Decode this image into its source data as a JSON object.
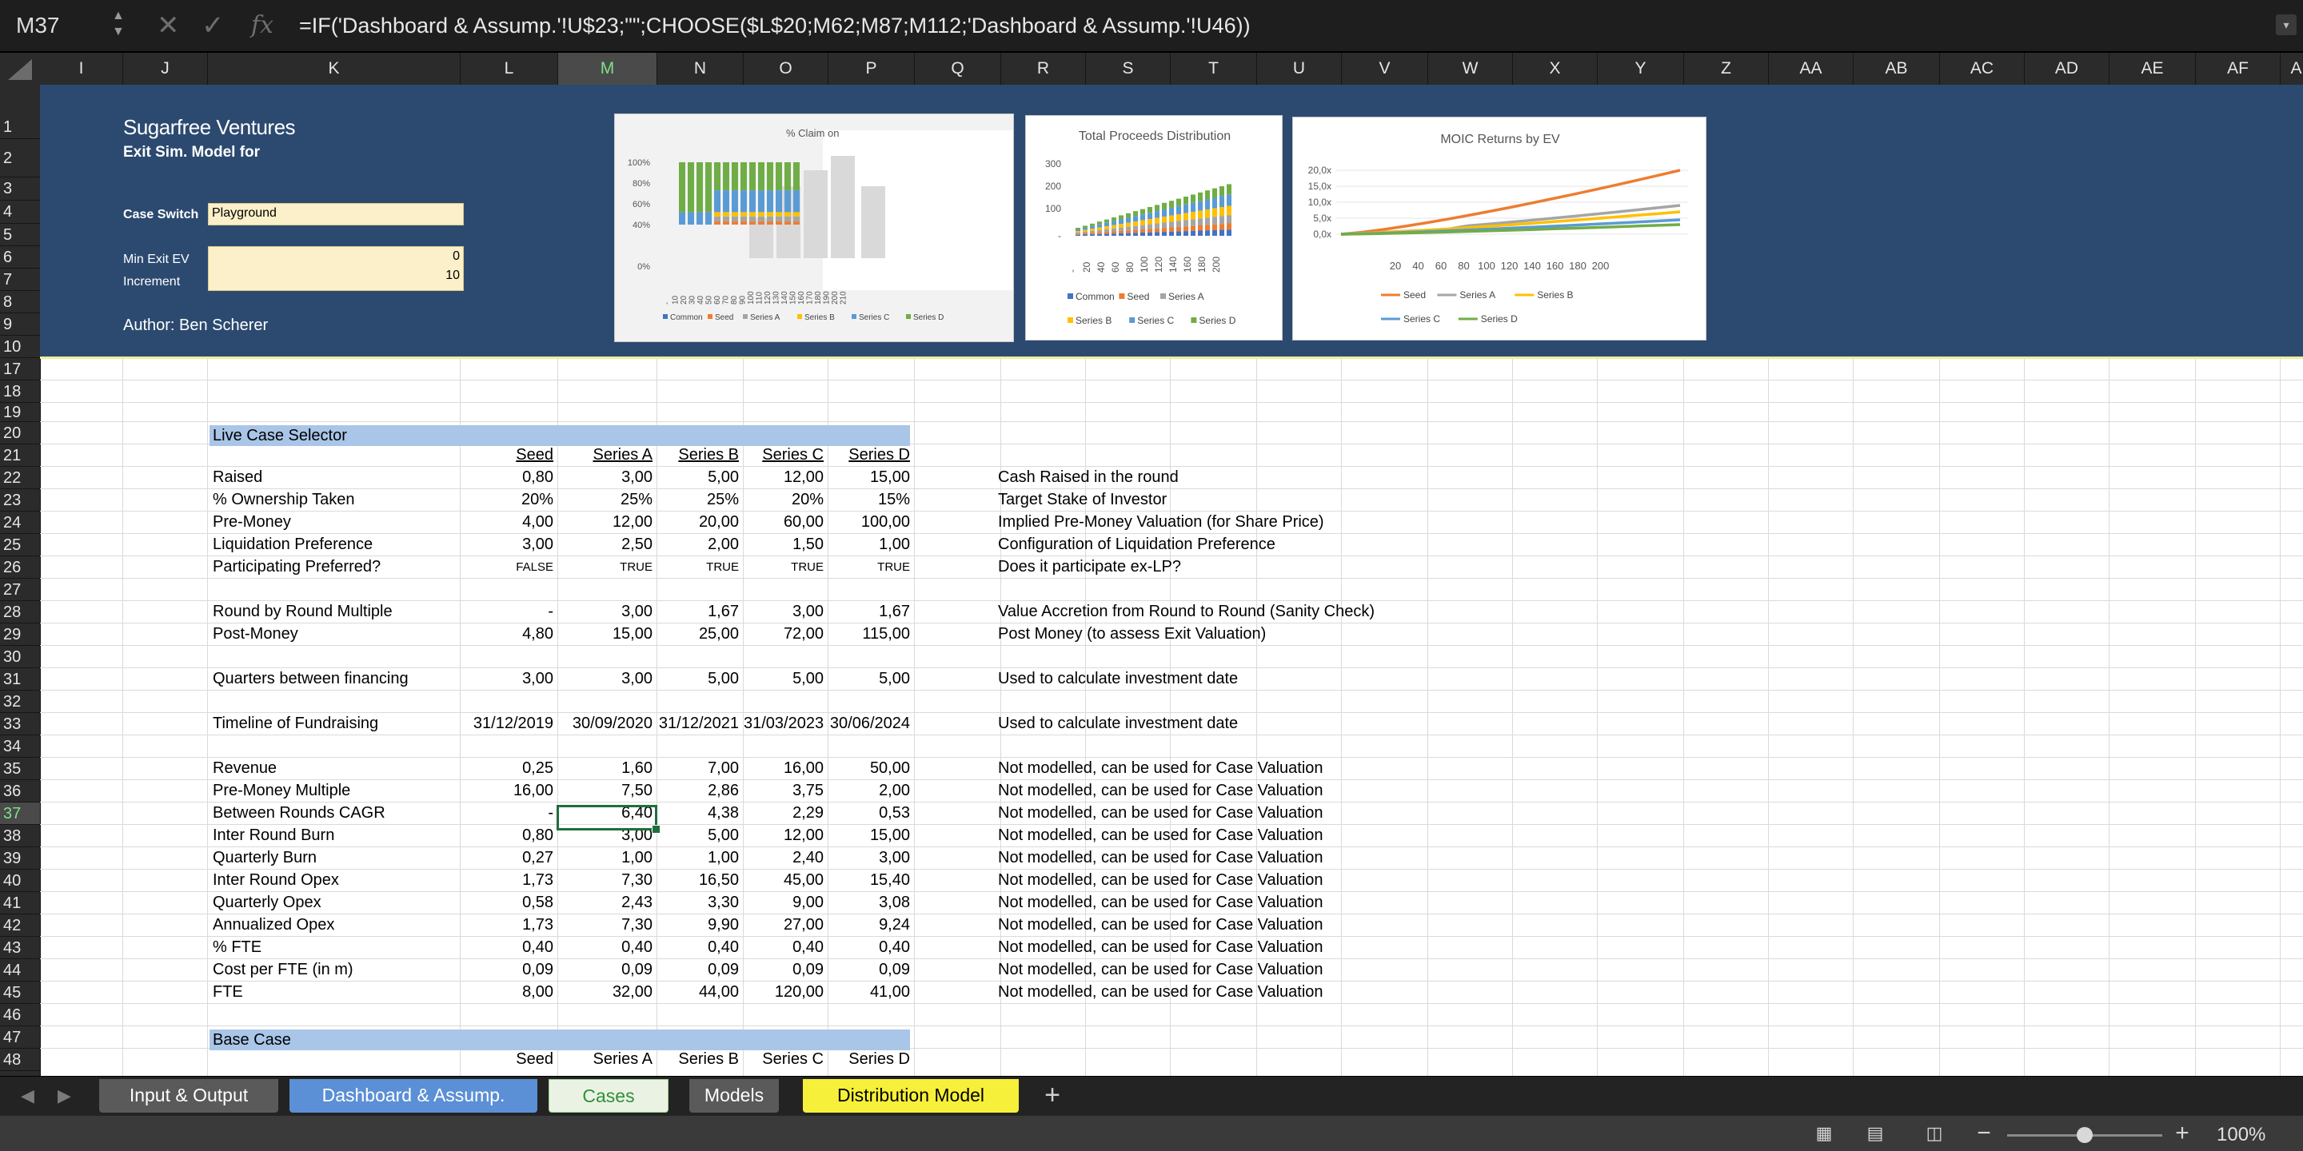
{
  "formula_bar": {
    "cell_ref": "M37",
    "formula": "=IF('Dashboard & Assump.'!U$23;\"\";CHOOSE($L$20;M62;M87;M112;'Dashboard & Assump.'!U46))",
    "cancel_icon": "close-icon",
    "enter_icon": "checkmark-icon",
    "fx_label": "fx"
  },
  "columns": [
    "I",
    "J",
    "K",
    "L",
    "M",
    "N",
    "O",
    "P",
    "Q",
    "R",
    "S",
    "T",
    "U",
    "V",
    "W",
    "X",
    "Y",
    "Z",
    "AA",
    "AB",
    "AC",
    "AD",
    "AE",
    "AF",
    "A"
  ],
  "selected_column": "M",
  "rows": [
    "1",
    "2",
    "3",
    "4",
    "5",
    "6",
    "7",
    "8",
    "9",
    "10",
    "17",
    "18",
    "19",
    "20",
    "21",
    "22",
    "23",
    "24",
    "25",
    "26",
    "27",
    "28",
    "29",
    "30",
    "31",
    "32",
    "33",
    "34",
    "35",
    "36",
    "37",
    "38",
    "39",
    "40",
    "41",
    "42",
    "43",
    "44",
    "45",
    "46",
    "47",
    "48"
  ],
  "selected_row": "37",
  "header": {
    "company": "Sugarfree Ventures",
    "subtitle": "Exit Sim. Model for",
    "case_switch_label": "Case Switch",
    "case_switch_value": "Playground",
    "min_exit_label": "Min Exit EV",
    "min_exit_value": "0",
    "increment_label": "Increment",
    "increment_value": "10",
    "author": "Author: Ben Scherer"
  },
  "charts": {
    "claim": {
      "title": "% Claim on",
      "yticks": [
        "100%",
        "80%",
        "60%",
        "40%",
        "0%"
      ],
      "xticks": [
        "-",
        "10",
        "20",
        "30",
        "40",
        "50",
        "60",
        "70",
        "80",
        "90",
        "100",
        "110",
        "120",
        "130",
        "140",
        "150",
        "160",
        "170",
        "180",
        "190",
        "200",
        "210"
      ],
      "legend": [
        "Common",
        "Seed",
        "Series A",
        "Series B",
        "Series C",
        "Series D"
      ]
    },
    "proceeds": {
      "title": "Total Proceeds Distribution",
      "yticks": [
        "300",
        "200",
        "100",
        "-"
      ],
      "xticks": [
        "-",
        "20",
        "40",
        "60",
        "80",
        "100",
        "120",
        "140",
        "160",
        "180",
        "200"
      ],
      "legend": [
        "Common",
        "Seed",
        "Series A",
        "Series B",
        "Series C",
        "Series D"
      ]
    },
    "moic": {
      "title": "MOIC Returns by EV",
      "yticks": [
        "20,0x",
        "15,0x",
        "10,0x",
        "5,0x",
        "0,0x"
      ],
      "xticks": [
        "20",
        "40",
        "60",
        "80",
        "100",
        "120",
        "140",
        "160",
        "180",
        "200"
      ],
      "legend": [
        "Seed",
        "Series A",
        "Series B",
        "Series C",
        "Series D"
      ]
    }
  },
  "series_colors": {
    "Common": "#4472c4",
    "Seed": "#ed7d31",
    "Series A": "#a5a5a5",
    "Series B": "#ffc000",
    "Series C": "#5b9bd5",
    "Series D": "#70ad47"
  },
  "live_case": {
    "title": "Live Case Selector",
    "headers": [
      "Seed",
      "Series A",
      "Series B",
      "Series C",
      "Series D"
    ],
    "rows": [
      {
        "row": "22",
        "label": "Raised",
        "values": [
          "0,80",
          "3,00",
          "5,00",
          "12,00",
          "15,00"
        ],
        "note": "Cash Raised in the round"
      },
      {
        "row": "23",
        "label": "% Ownership Taken",
        "values": [
          "20%",
          "25%",
          "25%",
          "20%",
          "15%"
        ],
        "note": "Target Stake of Investor"
      },
      {
        "row": "24",
        "label": "Pre-Money",
        "values": [
          "4,00",
          "12,00",
          "20,00",
          "60,00",
          "100,00"
        ],
        "note": "Implied Pre-Money Valuation (for Share Price)"
      },
      {
        "row": "25",
        "label": "Liquidation Preference",
        "values": [
          "3,00",
          "2,50",
          "2,00",
          "1,50",
          "1,00"
        ],
        "note": "Configuration of Liquidation Preference"
      },
      {
        "row": "26",
        "label": "Participating Preferred?",
        "values": [
          "FALSE",
          "TRUE",
          "TRUE",
          "TRUE",
          "TRUE"
        ],
        "note": "Does it participate ex-LP?",
        "small": true
      },
      {
        "row": "28",
        "label": "Round by Round Multiple",
        "values": [
          "-",
          "3,00",
          "1,67",
          "3,00",
          "1,67"
        ],
        "note": "Value Accretion from Round to Round (Sanity Check)"
      },
      {
        "row": "29",
        "label": "Post-Money",
        "values": [
          "4,80",
          "15,00",
          "25,00",
          "72,00",
          "115,00"
        ],
        "note": "Post Money (to assess Exit Valuation)"
      },
      {
        "row": "31",
        "label": "Quarters between financing",
        "values": [
          "3,00",
          "3,00",
          "5,00",
          "5,00",
          "5,00"
        ],
        "note": "Used to calculate investment date"
      },
      {
        "row": "33",
        "label": "Timeline of Fundraising",
        "values": [
          "31/12/2019",
          "30/09/2020",
          "31/12/2021",
          "31/03/2023",
          "30/06/2024"
        ],
        "note": "Used to calculate investment date"
      },
      {
        "row": "35",
        "label": "Revenue",
        "values": [
          "0,25",
          "1,60",
          "7,00",
          "16,00",
          "50,00"
        ],
        "note": "Not modelled, can be used for Case Valuation"
      },
      {
        "row": "36",
        "label": "Pre-Money Multiple",
        "values": [
          "16,00",
          "7,50",
          "2,86",
          "3,75",
          "2,00"
        ],
        "note": "Not modelled, can be used for Case Valuation"
      },
      {
        "row": "37",
        "label": "Between Rounds CAGR",
        "values": [
          "-",
          "6,40",
          "4,38",
          "2,29",
          "0,53"
        ],
        "note": "Not modelled, can be used for Case Valuation"
      },
      {
        "row": "38",
        "label": "Inter Round Burn",
        "values": [
          "0,80",
          "3,00",
          "5,00",
          "12,00",
          "15,00"
        ],
        "note": "Not modelled, can be used for Case Valuation"
      },
      {
        "row": "39",
        "label": "Quarterly Burn",
        "values": [
          "0,27",
          "1,00",
          "1,00",
          "2,40",
          "3,00"
        ],
        "note": "Not modelled, can be used for Case Valuation"
      },
      {
        "row": "40",
        "label": "Inter Round Opex",
        "values": [
          "1,73",
          "7,30",
          "16,50",
          "45,00",
          "15,40"
        ],
        "note": "Not modelled, can be used for Case Valuation"
      },
      {
        "row": "41",
        "label": "Quarterly Opex",
        "values": [
          "0,58",
          "2,43",
          "3,30",
          "9,00",
          "3,08"
        ],
        "note": "Not modelled, can be used for Case Valuation"
      },
      {
        "row": "42",
        "label": "Annualized Opex",
        "values": [
          "1,73",
          "7,30",
          "9,90",
          "27,00",
          "9,24"
        ],
        "note": "Not modelled, can be used for Case Valuation"
      },
      {
        "row": "43",
        "label": "% FTE",
        "values": [
          "0,40",
          "0,40",
          "0,40",
          "0,40",
          "0,40"
        ],
        "note": "Not modelled, can be used for Case Valuation"
      },
      {
        "row": "44",
        "label": "Cost per FTE (in m)",
        "values": [
          "0,09",
          "0,09",
          "0,09",
          "0,09",
          "0,09"
        ],
        "note": "Not modelled, can be used for Case Valuation"
      },
      {
        "row": "45",
        "label": "FTE",
        "values": [
          "8,00",
          "32,00",
          "44,00",
          "120,00",
          "41,00"
        ],
        "note": "Not modelled, can be used for Case Valuation"
      }
    ]
  },
  "base_case": {
    "title": "Base Case",
    "headers": [
      "Seed",
      "Series A",
      "Series B",
      "Series C",
      "Series D"
    ]
  },
  "sheet_tabs": [
    {
      "label": "Input & Output",
      "bg": "#5a5a5a",
      "fg": "#ffffff"
    },
    {
      "label": "Dashboard & Assump.",
      "bg": "#5b8fd6",
      "fg": "#ffffff"
    },
    {
      "label": "Cases",
      "bg": "#eaf3e3",
      "fg": "#2f8f3a"
    },
    {
      "label": "Models",
      "bg": "#5a5a5a",
      "fg": "#ffffff"
    },
    {
      "label": "Distribution Model",
      "bg": "#f6f03a",
      "fg": "#000000"
    }
  ],
  "active_tab": "Cases",
  "add_tab_label": "+",
  "status": {
    "zoom": "100%",
    "zoom_level": 0.5
  }
}
